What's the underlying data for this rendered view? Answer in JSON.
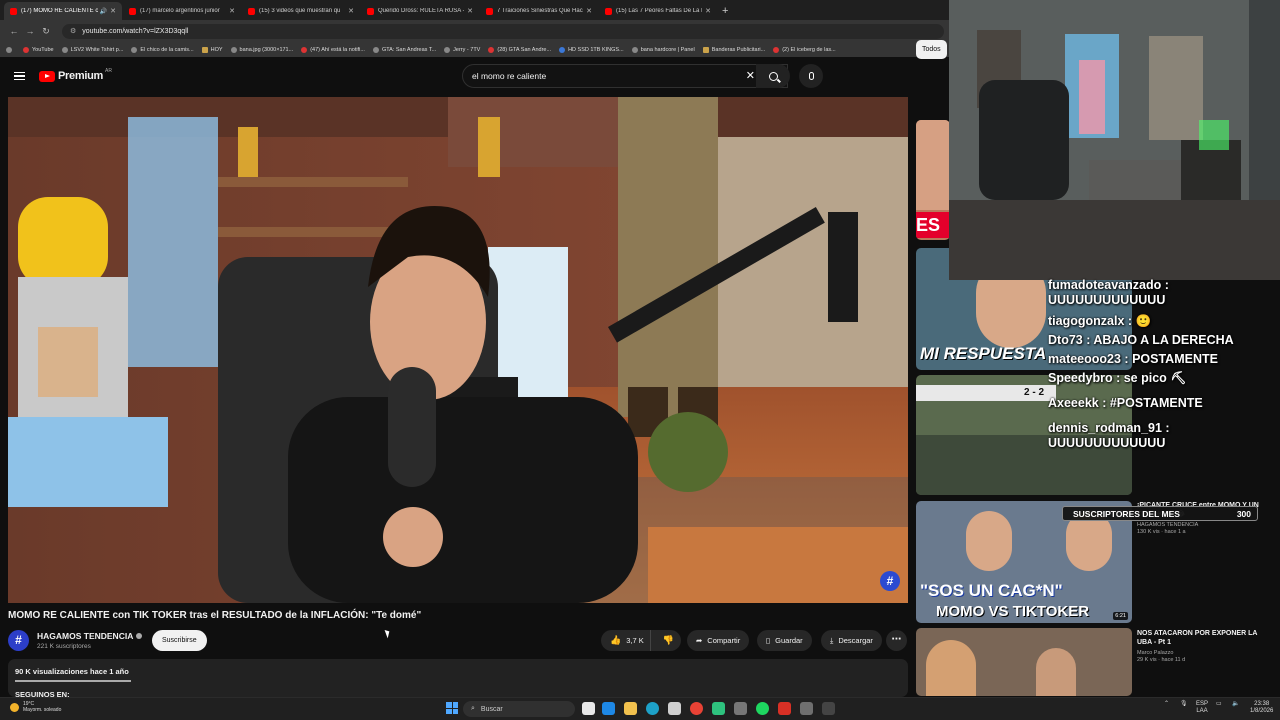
{
  "browser": {
    "tabs": [
      {
        "title": "(17) MOMO RE CALIENTE c",
        "active": true,
        "sound": true
      },
      {
        "title": "(17) marcelo argentinos junior",
        "active": false
      },
      {
        "title": "(15) 3 videos que muestran qu",
        "active": false
      },
      {
        "title": "Querido Dross: RULETA RUSA -",
        "active": false
      },
      {
        "title": "7 Traiciones Siniestras Que Hac",
        "active": false
      },
      {
        "title": "(15) Las 7 Peores Faltas De La I",
        "active": false
      }
    ],
    "url": "youtube.com/watch?v=lZX3D3qqll",
    "bookmarks": [
      "YouTube",
      "LSV2 White Tshirt p...",
      "El chico de la camis...",
      "HOY",
      "bana.jpg (3000×171...",
      "(47) Ahí está la notifi...",
      "GTA: San Andreas T...",
      "Jerry - 7TV",
      "(28) GTA San Andre...",
      "HD SSD 1TB KINGS...",
      "bana hardcore | Panel",
      "Banderas Publicitari...",
      "(2) El iceberg de las..."
    ]
  },
  "youtube": {
    "logo_word": "Premium",
    "country_code": "AR",
    "search_query": "el momo re caliente",
    "filter_chip": "Todos",
    "video": {
      "title": "MOMO RE CALIENTE con TIK TOKER tras el RESULTADO de la INFLACIÓN: \"Te domé\"",
      "channel": "HAGAMOS TENDENCIA",
      "subscribers": "221 K suscriptores",
      "subscribe_label": "Suscribirse",
      "likes": "3,7 K",
      "share_label": "Compartir",
      "save_label": "Guardar",
      "download_label": "Descargar",
      "stats": "90 K visualizaciones  hace 1 año",
      "desc_line": "SEGUINOS EN:"
    },
    "recommendations": [
      {
        "title": "",
        "channel": "",
        "meta": "",
        "duration": ""
      },
      {
        "title": "",
        "channel": "",
        "meta": "",
        "duration": ""
      },
      {
        "title": "",
        "channel": "",
        "meta": "",
        "duration": ""
      },
      {
        "title": "¡PICANTE CRUCE entre MOMO Y UN TIKTOKER! 😂",
        "channel": "HAGAMOS TENDENCIA",
        "meta": "130 K vis · hace 1 a",
        "duration": "6:21"
      },
      {
        "title": "NOS ATACARON POR EXPONER LA UBA - Pt 1",
        "channel": "Marco Palazzo",
        "meta": "29 K vis · hace 11 d",
        "duration": ""
      }
    ],
    "thumb_texts": {
      "respuesta": "MI RESPUESTA",
      "sos": "\"SOS UN CAG*N\"",
      "momo_vs": "MOMO VS TIKTOKER",
      "score": "2 - 2",
      "es": "ES"
    }
  },
  "stream_overlay": {
    "chat": [
      {
        "user": "fumadoteavanzado",
        "text": "UUUUUUUUUUUUU"
      },
      {
        "user": "tiagogonzalx",
        "text": "🙂"
      },
      {
        "user": "Dto73",
        "text": "ABAJO A LA DERECHA"
      },
      {
        "user": "mateeooo23",
        "text": "POSTAMENTE"
      },
      {
        "user": "Speedybro",
        "text": "se pico ⛏"
      },
      {
        "user": "Axeeekk",
        "text": "#POSTAMENTE"
      },
      {
        "user": "dennis_rodman_91",
        "text": "UUUUUUUUUUUUU"
      }
    ],
    "subs_label": "SUSCRIPTORES DEL MES",
    "subs_count": "300"
  },
  "taskbar": {
    "weather_temp": "19°C",
    "weather_desc": "Mayorm. soleado",
    "search_label": "Buscar",
    "lang": "ESP",
    "lang2": "LAA",
    "time": "23:38",
    "date": "1/8/2026"
  },
  "colors": {
    "yt_red": "#ff0000",
    "bg": "#0f0f0f",
    "chip": "#272727"
  }
}
